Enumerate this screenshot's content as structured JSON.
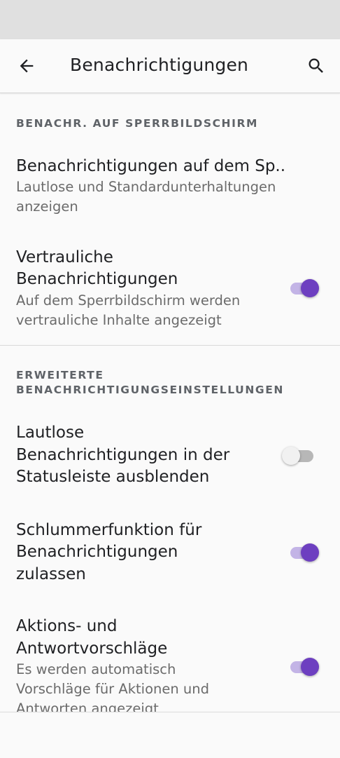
{
  "app_bar": {
    "title": "Benachrichtigungen",
    "back_icon": "arrow-back-icon",
    "search_icon": "search-icon"
  },
  "sections": [
    {
      "header": "BENACHR. AUF SPERRBILDSCHIRM",
      "items": [
        {
          "title": "Benachrichtigungen auf dem Sp..",
          "summary_lines": [
            "Lautlose und Standardunterhaltungen",
            "anzeigen"
          ]
        },
        {
          "title_lines": [
            "Vertrauliche",
            "Benachrichtigungen"
          ],
          "summary_lines": [
            "Auf dem Sperrbildschirm werden",
            "vertrauliche Inhalte angezeigt"
          ],
          "switch_on": true
        }
      ]
    },
    {
      "header_lines": [
        "ERWEITERTE",
        "BENACHRICHTIGUNGSEINSTELLUNGEN"
      ],
      "items": [
        {
          "title_lines": [
            "Lautlose",
            "Benachrichtigungen in der",
            "Statusleiste ausblenden"
          ],
          "switch_on": false
        },
        {
          "title_lines": [
            "Schlummerfunktion für",
            "Benachrichtigungen",
            "zulassen"
          ],
          "switch_on": true
        },
        {
          "title_lines": [
            "Aktions- und",
            "Antwortvorschläge"
          ],
          "summary_lines": [
            "Es werden automatisch",
            "Vorschläge für Aktionen und",
            "Antworten angezeigt"
          ],
          "switch_on": true
        }
      ]
    }
  ],
  "colors": {
    "accent": "#6d3fc0",
    "accent_track": "#c3b4e6",
    "background": "#fafafa"
  }
}
